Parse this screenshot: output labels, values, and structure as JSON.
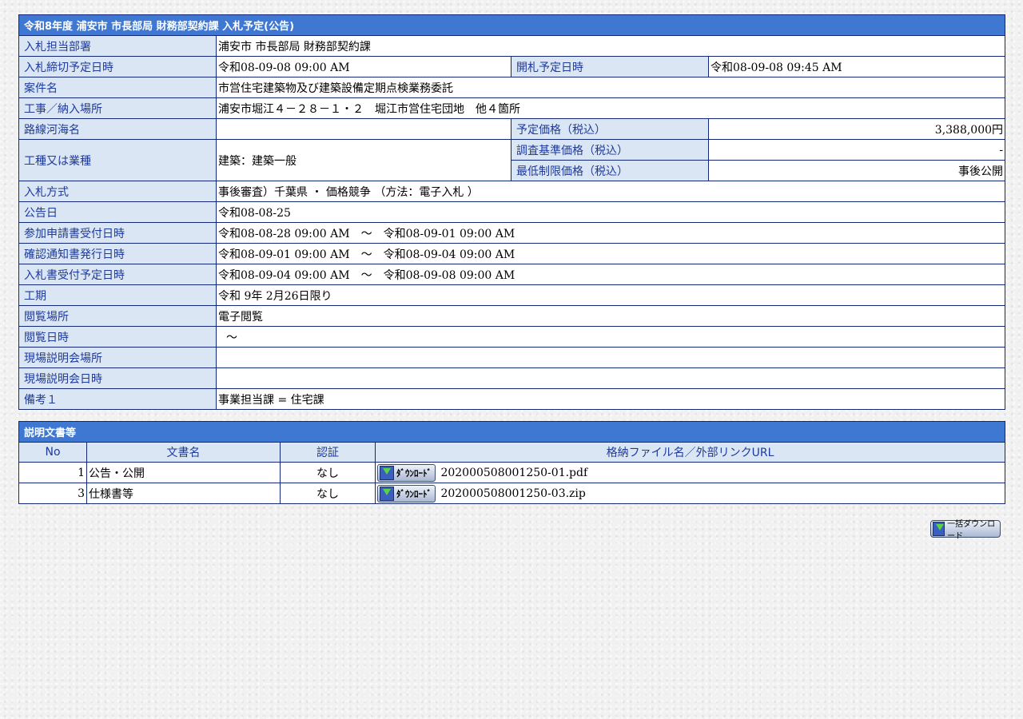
{
  "page": {
    "title": "令和8年度 浦安市 市長部局 財務部契約課 入札予定(公告)"
  },
  "details": {
    "dept": {
      "label": "入札担当部署",
      "value": "浦安市 市長部局 財務部契約課"
    },
    "deadline": {
      "label": "入札締切予定日時",
      "value": "令和08-09-08 09:00 AM"
    },
    "opening": {
      "label": "開札予定日時",
      "value": "令和08-09-08 09:45 AM"
    },
    "project": {
      "label": "案件名",
      "value": "市営住宅建築物及び建築設備定期点検業務委託"
    },
    "location": {
      "label": "工事／納入場所",
      "value": "浦安市堀江４－２８－１・２　堀江市営住宅団地　他４箇所"
    },
    "route": {
      "label": "路線河海名",
      "value": ""
    },
    "planned_price": {
      "label": "予定価格（税込）",
      "value": "3,388,000円"
    },
    "category": {
      "label": "工種又は業種",
      "value": "建築：建築一般"
    },
    "survey_price": {
      "label": "調査基準価格（税込）",
      "value": "-"
    },
    "min_price": {
      "label": "最低制限価格（税込）",
      "value": "事後公開"
    },
    "method": {
      "label": "入札方式",
      "value": "事後審査）千葉県 ・ 価格競争 （方法：電子入札 ）"
    },
    "notice_date": {
      "label": "公告日",
      "value": "令和08-08-25"
    },
    "application": {
      "label": "参加申請書受付日時",
      "value": "令和08-08-28 09:00 AM　～　令和08-09-01 09:00 AM"
    },
    "confirmation": {
      "label": "確認通知書発行日時",
      "value": "令和08-09-01 09:00 AM　～　令和08-09-04 09:00 AM"
    },
    "bid_receipt": {
      "label": "入札書受付予定日時",
      "value": "令和08-09-04 09:00 AM　～　令和08-09-08 09:00 AM"
    },
    "period": {
      "label": "工期",
      "value": "令和 9年 2月26日限り"
    },
    "viewing_place": {
      "label": "閲覧場所",
      "value": "電子閲覧"
    },
    "viewing_time": {
      "label": "閲覧日時",
      "value": "～"
    },
    "briefing_place": {
      "label": "現場説明会場所",
      "value": ""
    },
    "briefing_time": {
      "label": "現場説明会日時",
      "value": ""
    },
    "remarks": {
      "label": "備考１",
      "value": "事業担当課 = 住宅課"
    }
  },
  "docs": {
    "title": "説明文書等",
    "headers": {
      "no": "No",
      "name": "文書名",
      "auth": "認証",
      "file": "格納ファイル名／外部リンクURL"
    },
    "download_label": "ﾀﾞｳﾝﾛｰﾄﾞ",
    "rows": [
      {
        "no": "1",
        "name": "公告・公開",
        "auth": "なし",
        "file": "202000508001250-01.pdf"
      },
      {
        "no": "3",
        "name": "仕様書等",
        "auth": "なし",
        "file": "202000508001250-03.zip"
      }
    ],
    "bulk_label": "一括ダウンロード"
  },
  "icons": {
    "download": "download-icon"
  }
}
